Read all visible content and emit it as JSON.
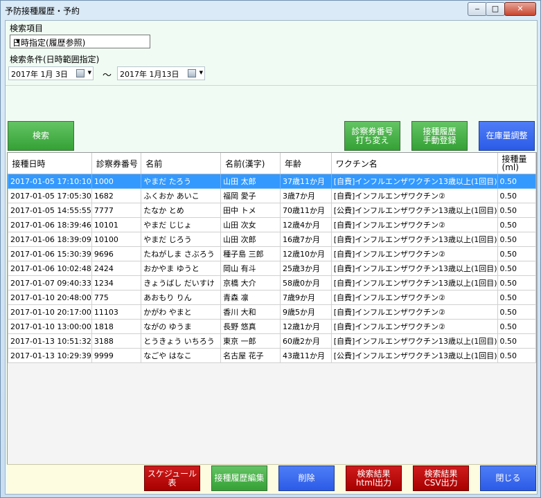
{
  "window": {
    "title": "予防接種履歴・予約",
    "minimize": "‒",
    "maximize": "□",
    "close": "✕"
  },
  "search_item": {
    "label": "検索項目",
    "selected": "日時指定(履歴参照)",
    "arrow": "▼"
  },
  "search_condition": {
    "label": "検索条件(日時範囲指定)",
    "from": "2017年  1月  3日",
    "to": "2017年  1月13日",
    "tilde": "～",
    "dropdown": "▼"
  },
  "buttons": {
    "search": "検索",
    "reissue": "診察券番号\n打ち変え",
    "manual": "接種履歴\n手動登録",
    "stock": "在庫量調整",
    "schedule": "スケジュール表",
    "edit": "接種履歴編集",
    "delete": "削除",
    "html_export": "検索結果\nhtml出力",
    "csv_export": "検索結果\nCSV出力",
    "close": "閉じる"
  },
  "colors": {
    "selected_row": "#3399ff",
    "green_button": "#35a135",
    "blue_button": "#2b5be7",
    "red_button": "#a80000"
  },
  "table": {
    "headers": [
      "接種日時",
      "診察券番号",
      "名前",
      "名前(漢字)",
      "年齢",
      "ワクチン名",
      "接種量\n(ml)"
    ],
    "selected_index": 0,
    "rows": [
      [
        "2017-01-05 17:10:10",
        "1000",
        "やまだ たろう",
        "山田 太郎",
        "37歳11か月",
        "[自費]インフルエンザワクチン13歳以上(1回目)",
        "0.50"
      ],
      [
        "2017-01-05 17:05:30",
        "1682",
        "ふくおか あいこ",
        "福岡 愛子",
        "3歳7か月",
        "[自費]インフルエンザワクチン②",
        "0.50"
      ],
      [
        "2017-01-05 14:55:55",
        "7777",
        "たなか とめ",
        "田中 トメ",
        "70歳11か月",
        "[公費]インフルエンザワクチン13歳以上(1回目)",
        "0.50"
      ],
      [
        "2017-01-06 18:39:46",
        "10101",
        "やまだ じじょ",
        "山田 次女",
        "12歳4か月",
        "[自費]インフルエンザワクチン②",
        "0.50"
      ],
      [
        "2017-01-06 18:39:09",
        "10100",
        "やまだ じろう",
        "山田 次郎",
        "16歳7か月",
        "[自費]インフルエンザワクチン13歳以上(1回目)",
        "0.50"
      ],
      [
        "2017-01-06 15:30:39",
        "9696",
        "たねがしま さぶろう",
        "種子島 三郎",
        "12歳10か月",
        "[自費]インフルエンザワクチン②",
        "0.50"
      ],
      [
        "2017-01-06 10:02:48",
        "2424",
        "おかやま ゆうと",
        "岡山 有斗",
        "25歳3か月",
        "[自費]インフルエンザワクチン13歳以上(1回目)",
        "0.50"
      ],
      [
        "2017-01-07 09:40:33",
        "1234",
        "きょうばし だいすけ",
        "京橋 大介",
        "58歳0か月",
        "[自費]インフルエンザワクチン13歳以上(1回目)",
        "0.50"
      ],
      [
        "2017-01-10 20:48:00",
        "775",
        "あおもり りん",
        "青森 凛",
        "7歳9か月",
        "[自費]インフルエンザワクチン②",
        "0.50"
      ],
      [
        "2017-01-10 20:17:00",
        "11103",
        "かがわ やまと",
        "香川 大和",
        "9歳5か月",
        "[自費]インフルエンザワクチン②",
        "0.50"
      ],
      [
        "2017-01-10 13:00:00",
        "1818",
        "ながの ゆうま",
        "長野 悠真",
        "12歳1か月",
        "[自費]インフルエンザワクチン②",
        "0.50"
      ],
      [
        "2017-01-13 10:51:32",
        "3188",
        "とうきょう いちろう",
        "東京 一郎",
        "60歳2か月",
        "[自費]インフルエンザワクチン13歳以上(1回目)",
        "0.50"
      ],
      [
        "2017-01-13 10:29:39",
        "9999",
        "なごや はなこ",
        "名古屋 花子",
        "43歳11か月",
        "[公費]インフルエンザワクチン13歳以上(1回目)",
        "0.50"
      ]
    ]
  }
}
